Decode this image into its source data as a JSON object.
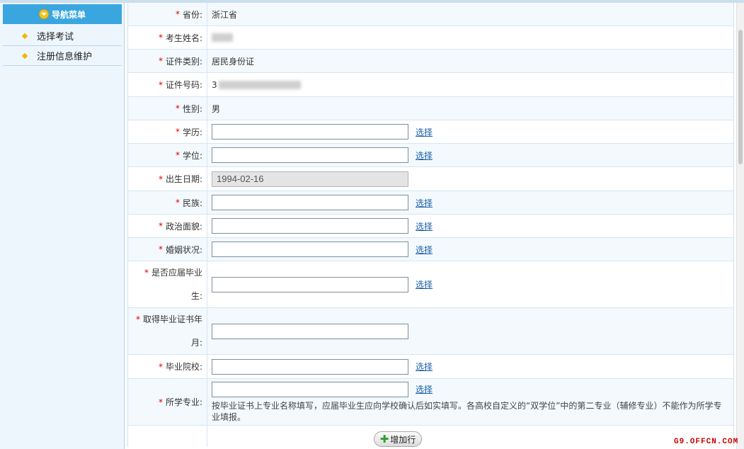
{
  "sidebar": {
    "header": "导航菜单",
    "items": [
      {
        "label": "选择考试"
      },
      {
        "label": "注册信息维护"
      }
    ]
  },
  "form": {
    "required_mark": "*",
    "select_label": "选择",
    "rows": {
      "province": {
        "label": "省份:",
        "value": "浙江省"
      },
      "name": {
        "label": "考生姓名:"
      },
      "id_type": {
        "label": "证件类别:",
        "value": "居民身份证"
      },
      "id_number": {
        "label": "证件号码:",
        "value": "3"
      },
      "gender": {
        "label": "性别:",
        "value": "男"
      },
      "education": {
        "label": "学历:",
        "value": ""
      },
      "degree": {
        "label": "学位:",
        "value": ""
      },
      "birth_date": {
        "label": "出生日期:",
        "value": "1994-02-16"
      },
      "ethnicity": {
        "label": "民族:",
        "value": ""
      },
      "politics": {
        "label": "政治面貌:",
        "value": ""
      },
      "marital": {
        "label": "婚姻状况:",
        "value": ""
      },
      "fresh_grad": {
        "label_line1": "是否应届毕业",
        "label_line2": "生:",
        "value": ""
      },
      "cert_date": {
        "label_line1": "取得毕业证书年",
        "label_line2": "月:",
        "value": ""
      },
      "school": {
        "label": "毕业院校:",
        "value": ""
      },
      "major": {
        "label": "所学专业:",
        "value": "",
        "note": "按毕业证书上专业名称填写，应届毕业生应向学校确认后如实填写。各高校自定义的“双学位”中的第二专业（辅修专业）不能作为所学专业填报。"
      }
    },
    "add_row_label": "增加行"
  },
  "watermark": "G9.OFFCN.COM"
}
